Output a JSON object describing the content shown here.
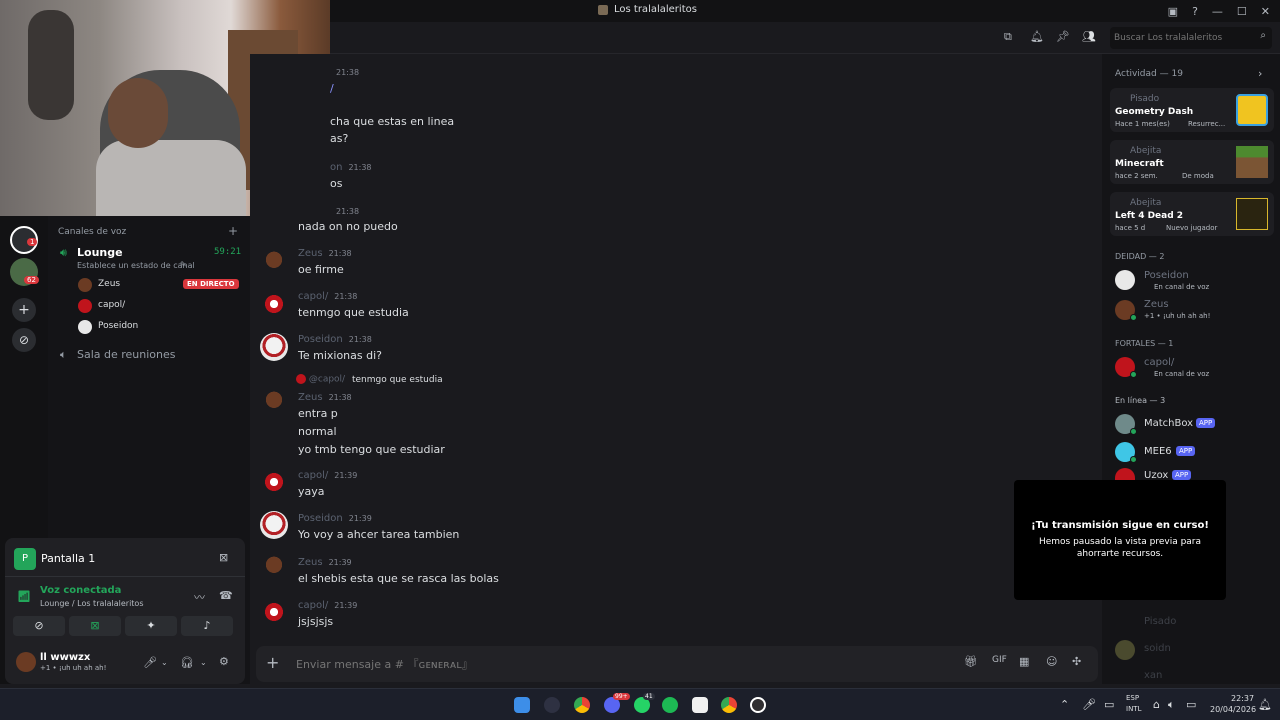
{
  "window": {
    "title": "Los tralalaleritos"
  },
  "search": {
    "placeholder": "Buscar Los tralalaleritos"
  },
  "channels": {
    "section": "Canales de voz",
    "lounge": {
      "name": "Lounge",
      "timer": "59:21",
      "status_prompt": "Establece un estado de canal"
    },
    "voice_users": [
      {
        "name": "Zeus",
        "badge": "EN DIRECTO"
      },
      {
        "name": "capol/"
      },
      {
        "name": "Poseidon"
      }
    ],
    "other": "Sala de reuniones"
  },
  "guild_badges": [
    "1",
    "62"
  ],
  "stream_panel": {
    "label": "Pantalla 1"
  },
  "voice": {
    "status": "Voz conectada",
    "location": "Lounge / Los tralalaleritos"
  },
  "user": {
    "name": "ll wwwzx",
    "status": "+1 • ¡uh uh ah ah!"
  },
  "messages": [
    {
      "author": "",
      "time": "21:38",
      "lines": [
        "/"
      ]
    },
    {
      "author": "",
      "time": "",
      "lines": [
        "cha que estas en linea",
        "as?"
      ]
    },
    {
      "author": "on",
      "time": "21:38",
      "lines": [
        "os"
      ]
    },
    {
      "author": "",
      "time": "21:38",
      "lines": [
        "nada on no puedo"
      ]
    },
    {
      "author": "Zeus",
      "time": "21:38",
      "lines": [
        "oe firme"
      ]
    },
    {
      "author": "capol/",
      "time": "21:38",
      "lines": [
        "tenmgo que estudia"
      ]
    },
    {
      "author": "Poseidon",
      "time": "21:38",
      "lines": [
        "Te mixionas di?"
      ]
    },
    {
      "author": "Zeus",
      "time": "21:38",
      "reply_to": "@capol/",
      "reply_text": "tenmgo que estudia",
      "lines": [
        "entra p",
        "normal",
        "yo tmb tengo que estudiar"
      ]
    },
    {
      "author": "capol/",
      "time": "21:39",
      "lines": [
        "yaya"
      ]
    },
    {
      "author": "Poseidon",
      "time": "21:39",
      "lines": [
        "Yo voy a ahcer tarea tambien"
      ]
    },
    {
      "author": "Zeus",
      "time": "21:39",
      "lines": [
        "el shebis esta que se rasca las bolas"
      ]
    },
    {
      "author": "capol/",
      "time": "21:39",
      "lines": [
        "jsjsjsjs"
      ]
    }
  ],
  "composer": {
    "placeholder": "Enviar mensaje a # 『ɢᴇɴᴇʀᴀʟ』"
  },
  "activity": {
    "header": "Actividad — 19",
    "cards": [
      {
        "user": "Pisado",
        "game": "Geometry Dash",
        "meta": "Hace 1 mes(es)",
        "extra": "Resurrec..."
      },
      {
        "user": "Abejita",
        "game": "Minecraft",
        "meta": "hace 2 sem.",
        "extra": "De moda"
      },
      {
        "user": "Abejita",
        "game": "Left 4 Dead 2",
        "meta": "hace 5 d",
        "extra": "Nuevo jugador"
      }
    ]
  },
  "member_groups": [
    {
      "title": "DEIDAD — 2",
      "members": [
        {
          "name": "Poseidon",
          "status": "En canal de voz"
        },
        {
          "name": "Zeus",
          "status": "+1 • ¡uh uh ah ah!"
        }
      ]
    },
    {
      "title": "FORTALES — 1",
      "members": [
        {
          "name": "capol/",
          "status": "En canal de voz"
        }
      ]
    },
    {
      "title": "En línea — 3",
      "members": [
        {
          "name": "MatchBox",
          "badge": "APP"
        },
        {
          "name": "MEE6",
          "badge": "APP"
        },
        {
          "name": "Uzox",
          "badge": "APP"
        }
      ]
    }
  ],
  "faded_members": [
    "Pisado",
    "soidn",
    "xan"
  ],
  "toast": {
    "title": "¡Tu transmisión sigue en curso!",
    "body": "Hemos pausado la vista previa para ahorrarte recursos."
  },
  "taskbar": {
    "lang": "ESP",
    "layout": "INTL",
    "time": "22:37",
    "date": "20/04/2026",
    "badges": [
      "99+",
      "41"
    ]
  },
  "colors": {
    "accent": "#5865f2",
    "online": "#23a55a",
    "live": "#da373c"
  }
}
